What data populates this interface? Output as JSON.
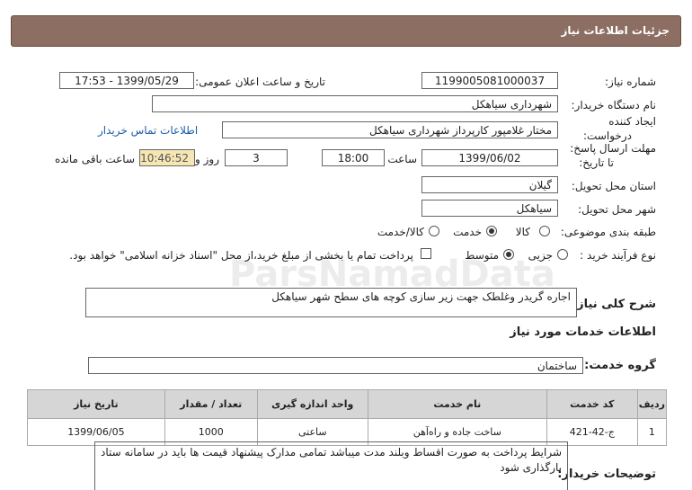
{
  "header": {
    "title": "جزئیات اطلاعات نیاز"
  },
  "need_number": {
    "label": "شماره نیاز:",
    "value": "1199005081000037"
  },
  "announce": {
    "label": "تاریخ و ساعت اعلان عمومی:",
    "value": "1399/05/29 - 17:53"
  },
  "buyer": {
    "label": "نام دستگاه خریدار:",
    "value": "شهرداری سیاهکل"
  },
  "creator": {
    "label_line1": "ایجاد کننده",
    "label_line2": "درخواست:",
    "value": "مختار غلامپور کارپرداز شهرداری سیاهکل",
    "contact_link": "اطلاعات تماس خریدار"
  },
  "deadline": {
    "label_line1": "مهلت ارسال پاسخ:",
    "label_line2": "تا تاریخ:",
    "date": "1399/06/02",
    "time_label": "ساعت",
    "time": "18:00",
    "days": "3",
    "days_label": "روز و",
    "remaining": "10:46:52",
    "remaining_label": "ساعت باقی مانده"
  },
  "province": {
    "label": "استان محل تحویل:",
    "value": "گیلان"
  },
  "city": {
    "label": "شهر محل تحویل:",
    "value": "سیاهکل"
  },
  "category": {
    "label": "طبقه بندی موضوعی:",
    "options": [
      "کالا",
      "خدمت",
      "کالا/خدمت"
    ],
    "selected": "خدمت"
  },
  "process": {
    "label": "نوع فرآیند خرید :",
    "options": [
      "جزیی",
      "متوسط"
    ],
    "selected": "متوسط",
    "payment_note": "پرداخت تمام یا بخشی از مبلغ خرید،از محل \"اسناد خزانه اسلامی\" خواهد بود."
  },
  "description": {
    "label": "شرح کلی نیاز:",
    "value": "اجاره گریدر وغلطک جهت زیر سازی کوچه های سطح شهر سیاهکل"
  },
  "services_info": {
    "title": "اطلاعات خدمات مورد نیاز"
  },
  "service_group": {
    "label": "گروه خدمت:",
    "value": "ساختمان"
  },
  "table": {
    "headers": [
      "ردیف",
      "کد خدمت",
      "نام خدمت",
      "واحد اندازه گیری",
      "تعداد / مقدار",
      "تاریخ نیاز"
    ],
    "rows": [
      [
        "1",
        "ج-42-421",
        "ساخت جاده و راه‌آهن",
        "ساعتی",
        "1000",
        "1399/06/05"
      ]
    ]
  },
  "buyer_notes": {
    "label": "توضیحات خریدار:",
    "value": "شرایط پرداخت به صورت اقساط وبلند مدت میباشد تمامی مدارک پیشنهاد قیمت ها باید در سامانه ستاد بارگذاری شود"
  },
  "watermark": {
    "brand": "ParsNamadData"
  }
}
